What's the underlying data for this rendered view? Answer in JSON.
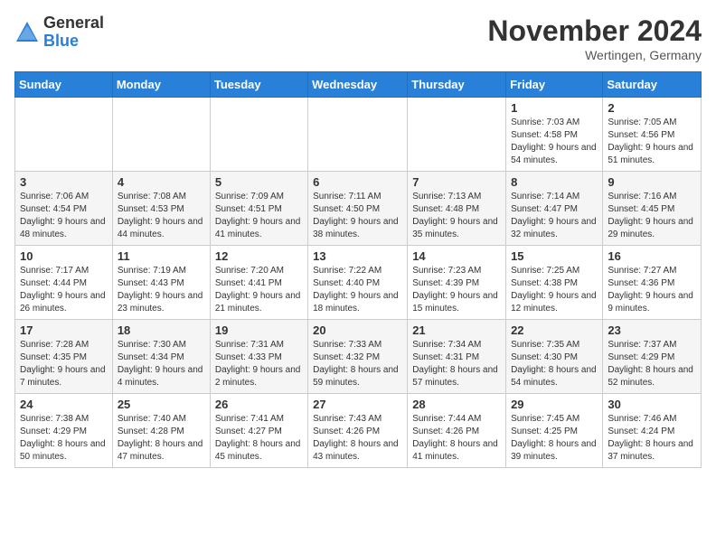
{
  "header": {
    "logo_general": "General",
    "logo_blue": "Blue",
    "month_title": "November 2024",
    "location": "Wertingen, Germany"
  },
  "weekdays": [
    "Sunday",
    "Monday",
    "Tuesday",
    "Wednesday",
    "Thursday",
    "Friday",
    "Saturday"
  ],
  "rows": [
    [
      {
        "day": "",
        "info": ""
      },
      {
        "day": "",
        "info": ""
      },
      {
        "day": "",
        "info": ""
      },
      {
        "day": "",
        "info": ""
      },
      {
        "day": "",
        "info": ""
      },
      {
        "day": "1",
        "info": "Sunrise: 7:03 AM\nSunset: 4:58 PM\nDaylight: 9 hours\nand 54 minutes."
      },
      {
        "day": "2",
        "info": "Sunrise: 7:05 AM\nSunset: 4:56 PM\nDaylight: 9 hours\nand 51 minutes."
      }
    ],
    [
      {
        "day": "3",
        "info": "Sunrise: 7:06 AM\nSunset: 4:54 PM\nDaylight: 9 hours\nand 48 minutes."
      },
      {
        "day": "4",
        "info": "Sunrise: 7:08 AM\nSunset: 4:53 PM\nDaylight: 9 hours\nand 44 minutes."
      },
      {
        "day": "5",
        "info": "Sunrise: 7:09 AM\nSunset: 4:51 PM\nDaylight: 9 hours\nand 41 minutes."
      },
      {
        "day": "6",
        "info": "Sunrise: 7:11 AM\nSunset: 4:50 PM\nDaylight: 9 hours\nand 38 minutes."
      },
      {
        "day": "7",
        "info": "Sunrise: 7:13 AM\nSunset: 4:48 PM\nDaylight: 9 hours\nand 35 minutes."
      },
      {
        "day": "8",
        "info": "Sunrise: 7:14 AM\nSunset: 4:47 PM\nDaylight: 9 hours\nand 32 minutes."
      },
      {
        "day": "9",
        "info": "Sunrise: 7:16 AM\nSunset: 4:45 PM\nDaylight: 9 hours\nand 29 minutes."
      }
    ],
    [
      {
        "day": "10",
        "info": "Sunrise: 7:17 AM\nSunset: 4:44 PM\nDaylight: 9 hours\nand 26 minutes."
      },
      {
        "day": "11",
        "info": "Sunrise: 7:19 AM\nSunset: 4:43 PM\nDaylight: 9 hours\nand 23 minutes."
      },
      {
        "day": "12",
        "info": "Sunrise: 7:20 AM\nSunset: 4:41 PM\nDaylight: 9 hours\nand 21 minutes."
      },
      {
        "day": "13",
        "info": "Sunrise: 7:22 AM\nSunset: 4:40 PM\nDaylight: 9 hours\nand 18 minutes."
      },
      {
        "day": "14",
        "info": "Sunrise: 7:23 AM\nSunset: 4:39 PM\nDaylight: 9 hours\nand 15 minutes."
      },
      {
        "day": "15",
        "info": "Sunrise: 7:25 AM\nSunset: 4:38 PM\nDaylight: 9 hours\nand 12 minutes."
      },
      {
        "day": "16",
        "info": "Sunrise: 7:27 AM\nSunset: 4:36 PM\nDaylight: 9 hours\nand 9 minutes."
      }
    ],
    [
      {
        "day": "17",
        "info": "Sunrise: 7:28 AM\nSunset: 4:35 PM\nDaylight: 9 hours\nand 7 minutes."
      },
      {
        "day": "18",
        "info": "Sunrise: 7:30 AM\nSunset: 4:34 PM\nDaylight: 9 hours\nand 4 minutes."
      },
      {
        "day": "19",
        "info": "Sunrise: 7:31 AM\nSunset: 4:33 PM\nDaylight: 9 hours\nand 2 minutes."
      },
      {
        "day": "20",
        "info": "Sunrise: 7:33 AM\nSunset: 4:32 PM\nDaylight: 8 hours\nand 59 minutes."
      },
      {
        "day": "21",
        "info": "Sunrise: 7:34 AM\nSunset: 4:31 PM\nDaylight: 8 hours\nand 57 minutes."
      },
      {
        "day": "22",
        "info": "Sunrise: 7:35 AM\nSunset: 4:30 PM\nDaylight: 8 hours\nand 54 minutes."
      },
      {
        "day": "23",
        "info": "Sunrise: 7:37 AM\nSunset: 4:29 PM\nDaylight: 8 hours\nand 52 minutes."
      }
    ],
    [
      {
        "day": "24",
        "info": "Sunrise: 7:38 AM\nSunset: 4:29 PM\nDaylight: 8 hours\nand 50 minutes."
      },
      {
        "day": "25",
        "info": "Sunrise: 7:40 AM\nSunset: 4:28 PM\nDaylight: 8 hours\nand 47 minutes."
      },
      {
        "day": "26",
        "info": "Sunrise: 7:41 AM\nSunset: 4:27 PM\nDaylight: 8 hours\nand 45 minutes."
      },
      {
        "day": "27",
        "info": "Sunrise: 7:43 AM\nSunset: 4:26 PM\nDaylight: 8 hours\nand 43 minutes."
      },
      {
        "day": "28",
        "info": "Sunrise: 7:44 AM\nSunset: 4:26 PM\nDaylight: 8 hours\nand 41 minutes."
      },
      {
        "day": "29",
        "info": "Sunrise: 7:45 AM\nSunset: 4:25 PM\nDaylight: 8 hours\nand 39 minutes."
      },
      {
        "day": "30",
        "info": "Sunrise: 7:46 AM\nSunset: 4:24 PM\nDaylight: 8 hours\nand 37 minutes."
      }
    ]
  ]
}
